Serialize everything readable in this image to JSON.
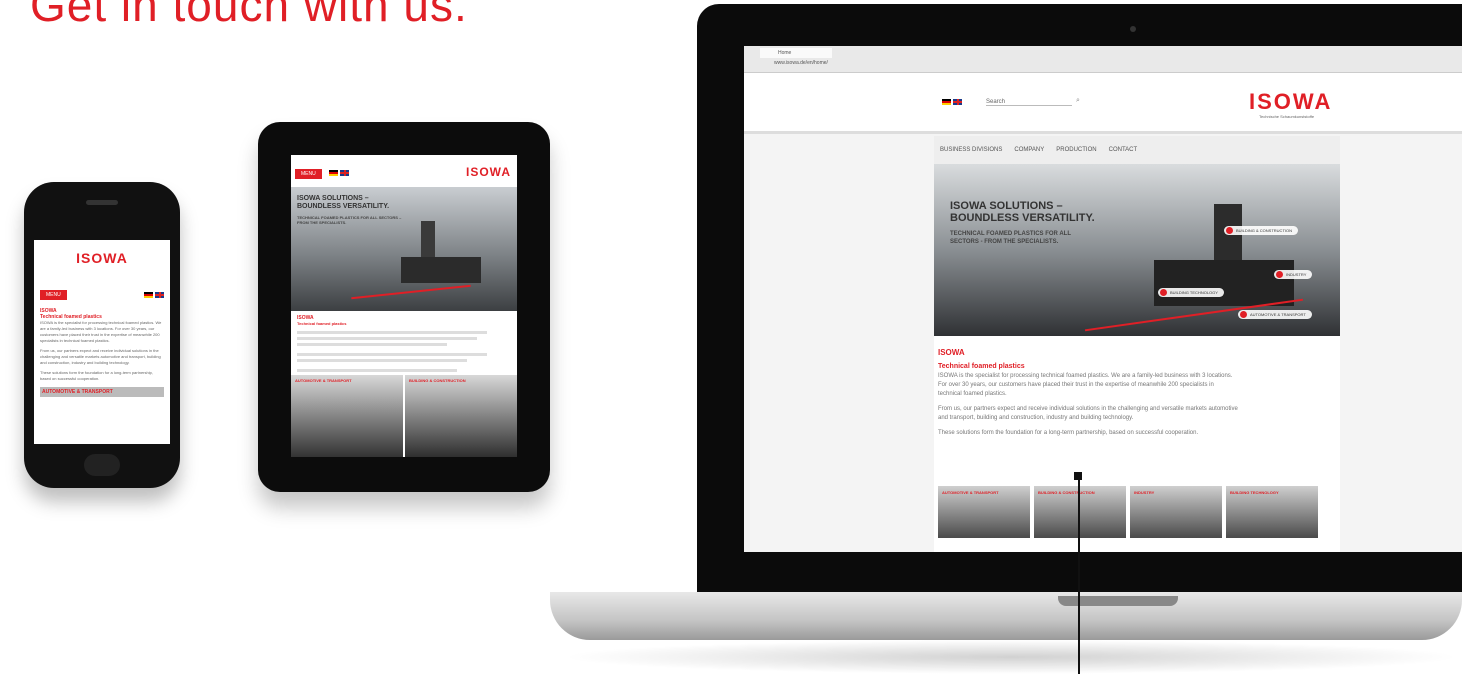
{
  "headline": "Get in touch with us.",
  "phone": {
    "logo": "ISOWA",
    "menu": "MENU",
    "heading": "ISOWA",
    "subheading": "Technical foamed plastics",
    "paragraph1": "ISOWA is the specialist for processing technical foamed plastics. We are a family-led business with 3 locations. For over 30 years, our customers have placed their trust in the expertise of meanwhile 200 specialists in technical foamed plastics.",
    "paragraph2": "From us, our partners expect and receive individual solutions in the challenging and versatile markets automotive and transport, building and construction, industry and building technology.",
    "paragraph3": "These solutions form the foundation for a long-term partnership, based on successful cooperation.",
    "category": "AUTOMOTIVE & TRANSPORT"
  },
  "tablet": {
    "logo": "ISOWA",
    "menu": "MENU",
    "hero_title": "ISOWA SOLUTIONS – BOUNDLESS VERSATILITY.",
    "hero_sub": "TECHNICAL FOAMED PLASTICS FOR ALL SECTORS – FROM THE SPECIALISTS.",
    "heading": "ISOWA",
    "subheading": "Technical foamed plastics",
    "cat1": "AUTOMOTIVE & TRANSPORT",
    "cat2": "BUILDING & CONSTRUCTION"
  },
  "laptop": {
    "tab_title": "Home",
    "url": "www.isowa.de/en/home/",
    "search_placeholder": "Search",
    "logo": "ISOWA",
    "logo_sub": "Technische Schaumkunststoffe",
    "nav": [
      "BUSINESS DIVISIONS",
      "COMPANY",
      "PRODUCTION",
      "CONTACT"
    ],
    "hero_title_1": "ISOWA SOLUTIONS –",
    "hero_title_2": "BOUNDLESS VERSATILITY.",
    "hero_sub": "TECHNICAL FOAMED PLASTICS FOR ALL SECTORS - FROM THE SPECIALISTS.",
    "tags": [
      "BUILDING & CONSTRUCTION",
      "INDUSTRY",
      "BUILDING TECHNOLOGY",
      "AUTOMOTIVE & TRANSPORT"
    ],
    "heading": "ISOWA",
    "subheading": "Technical foamed plastics",
    "p1": "ISOWA is the specialist for processing technical foamed plastics. We are a family-led business with 3 locations. For over 30 years, our customers have placed their trust in the expertise of meanwhile 200 specialists in technical foamed plastics.",
    "p2": "From us, our partners expect and receive individual solutions in the challenging and versatile markets automotive and transport, building and construction, industry and building technology.",
    "p3": "These solutions form the foundation for a long-term partnership, based on successful cooperation.",
    "thumbs": [
      "AUTOMOTIVE & TRANSPORT",
      "BUILDING & CONSTRUCTION",
      "INDUSTRY",
      "BUILDING TECHNOLOGY"
    ]
  }
}
